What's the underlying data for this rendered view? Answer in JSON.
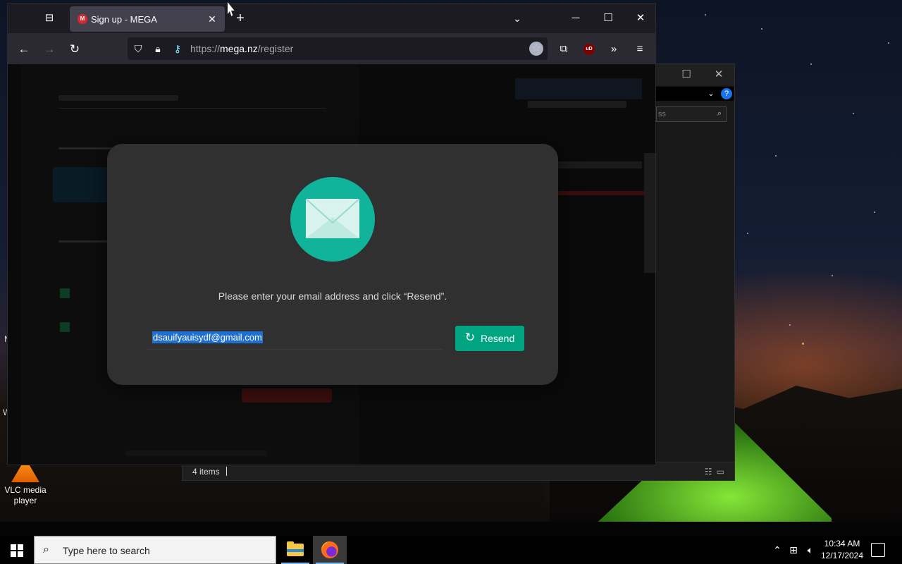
{
  "desktop": {
    "icons": [
      {
        "label": "VLC media player"
      }
    ],
    "edge_glyphs": [
      "N",
      "W"
    ]
  },
  "explorer": {
    "search_placeholder": "ss",
    "help": "?",
    "status_items": "4 items"
  },
  "browser": {
    "tab": {
      "favicon": "M",
      "title": "Sign up - MEGA"
    },
    "url": {
      "scheme": "https://",
      "host": "mega.nz",
      "path": "/register"
    },
    "ublock_label": "uD"
  },
  "modal": {
    "icon": "envelope-icon",
    "prompt": "Please enter your email address and click “Resend”.",
    "email_value": "dsauifyauisydf@gmail.com",
    "resend_label": "Resend",
    "colors": {
      "icon_circle": "#12b39b",
      "button": "#00a382"
    }
  },
  "taskbar": {
    "search_placeholder": "Type here to search",
    "time": "10:34 AM",
    "date": "12/17/2024"
  }
}
